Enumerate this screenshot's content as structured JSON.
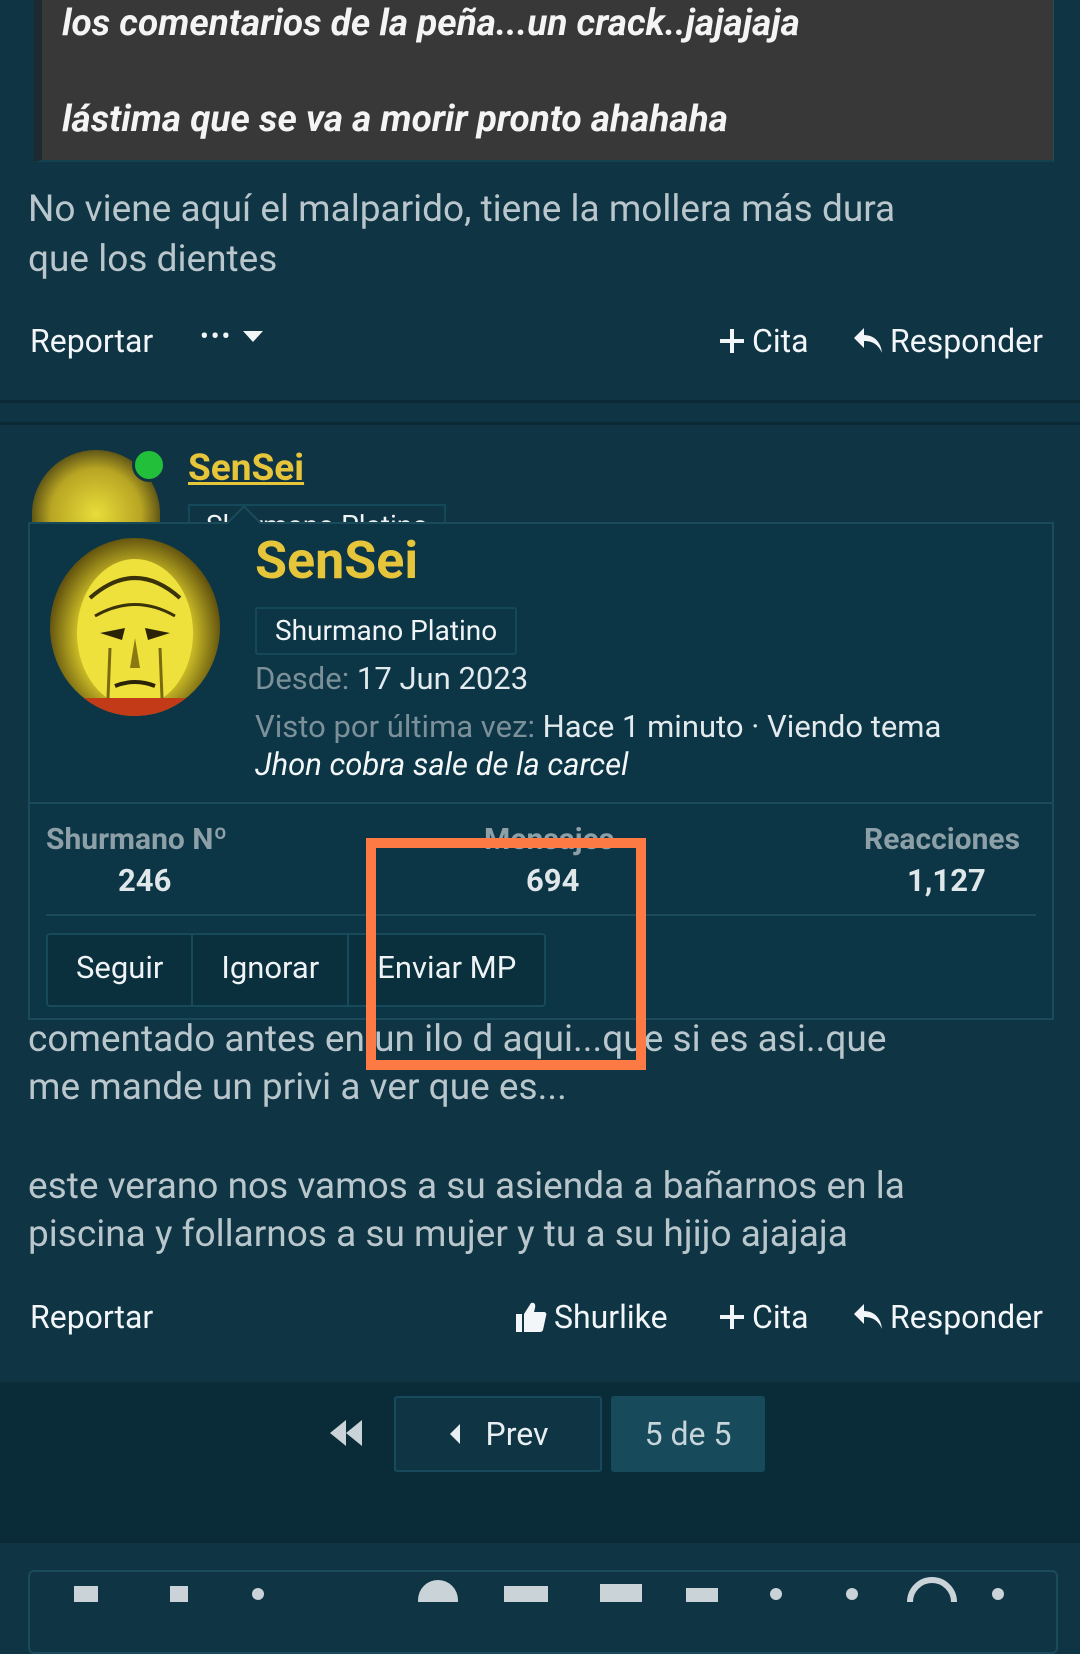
{
  "quote": {
    "line1": "los comentarios de la peña...un crack..jajajaja",
    "line2": "lástima que se va a morir pronto ahahaha"
  },
  "post1": {
    "text_line1": "No viene aquí el malparido, tiene la mollera más dura",
    "text_line2": "que los dientes",
    "report": "Reportar",
    "more": "•••",
    "quote_btn": "Cita",
    "reply": "Responder"
  },
  "post2": {
    "username": "SenSei",
    "rank_partial": "Shurmano Platino",
    "text_line1": "comentado antes en un ilo d aqui...que si es asi..que",
    "text_line2": "me mande un privi a ver que es...",
    "text_line3": "este verano nos vamos a su asienda a bañarnos en la",
    "text_line4": "piscina y follarnos a su mujer y tu a su hjijo ajajaja",
    "report": "Reportar",
    "like": "Shurlike",
    "quote_btn": "Cita",
    "reply": "Responder"
  },
  "popup": {
    "name": "SenSei",
    "rank": "Shurmano Platino",
    "since_label": "Desde:",
    "since_value": "17 Jun 2023",
    "seen_label": "Visto por última vez:",
    "seen_value": "Hace 1 minuto · Viendo tema",
    "thread": "Jhon cobra sale de la carcel",
    "stats": {
      "member_label": "Shurmano Nº",
      "member_value": "246",
      "messages_label": "Mensajes",
      "messages_value": "694",
      "reactions_label": "Reacciones",
      "reactions_value": "1,127"
    },
    "buttons": {
      "follow": "Seguir",
      "ignore": "Ignorar",
      "pm": "Enviar MP"
    }
  },
  "pager": {
    "prev": "Prev",
    "page": "5 de 5"
  },
  "colors": {
    "background": "#0f3444",
    "username": "#e6c53b",
    "highlight": "#fd7a45",
    "online": "#22c03a"
  }
}
